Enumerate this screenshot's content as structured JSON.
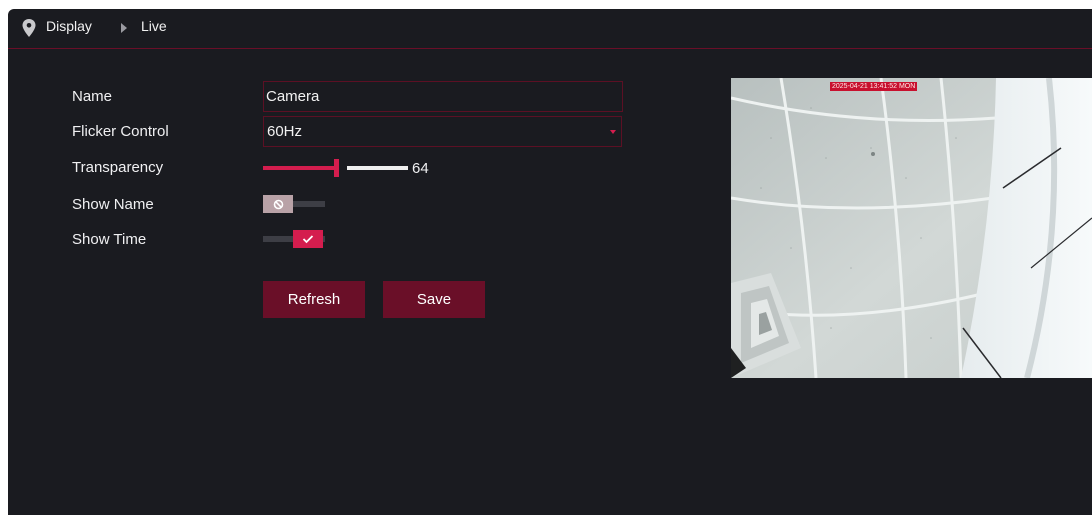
{
  "breadcrumb": {
    "items": [
      "Display",
      "Live"
    ]
  },
  "form": {
    "name": {
      "label": "Name",
      "value": "Camera"
    },
    "flicker": {
      "label": "Flicker Control",
      "value": "60Hz"
    },
    "transparency": {
      "label": "Transparency",
      "value": "64",
      "fraction": 0.5
    },
    "show_name": {
      "label": "Show Name",
      "enabled": false
    },
    "show_time": {
      "label": "Show Time",
      "enabled": true
    }
  },
  "buttons": {
    "refresh": "Refresh",
    "save": "Save"
  },
  "preview": {
    "timestamp": "2025-04-21 13:41:52 MON"
  },
  "colors": {
    "accent": "#d41d4e",
    "button_bg": "#6a0f28",
    "panel_bg": "#1a1b20"
  },
  "icons": [
    "location-pin-icon",
    "caret-right-icon",
    "caret-down-icon",
    "ban-icon",
    "check-icon"
  ]
}
